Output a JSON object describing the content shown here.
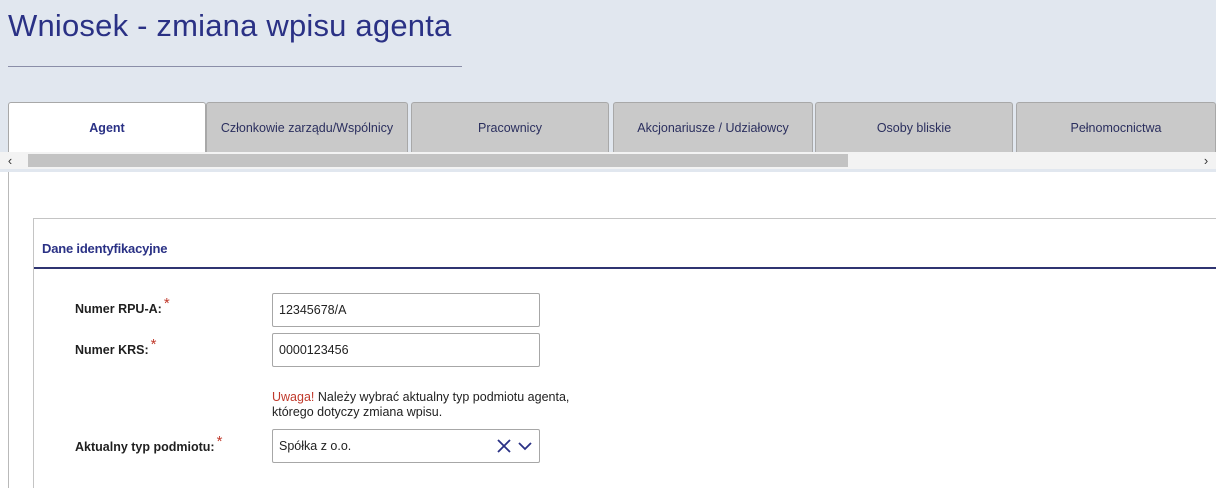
{
  "header": {
    "title": "Wniosek - zmiana wpisu agenta"
  },
  "tabs": [
    {
      "label": "Agent"
    },
    {
      "label": "Członkowie zarządu/Wspólnicy"
    },
    {
      "label": "Pracownicy"
    },
    {
      "label": "Akcjonariusze / Udziałowcy"
    },
    {
      "label": "Osoby bliskie"
    },
    {
      "label": "Pełnomocnictwa"
    }
  ],
  "active_tab": "Agent",
  "scroll": {
    "left_glyph": "‹",
    "right_glyph": "›"
  },
  "section": {
    "title": "Dane identyfikacyjne",
    "required_marker": "*",
    "fields": {
      "rpu": {
        "label": "Numer RPU-A:",
        "value": "12345678/A"
      },
      "krs": {
        "label": "Numer KRS:",
        "value": "0000123456"
      },
      "entity_type": {
        "label": "Aktualny typ podmiotu:",
        "value": "Spółka z o.o.",
        "warning_prefix": "Uwaga!",
        "warning_text": " Należy wybrać aktualny typ podmiotu agenta, którego dotyczy zmiana wpisu."
      }
    }
  },
  "colors": {
    "accent": "#2a3185",
    "required": "#c0392b",
    "header_bg": "#e1e7ef",
    "tab_inactive": "#c9c9c9"
  },
  "icons": {
    "clear": "close-icon",
    "expand": "chevron-down-icon"
  }
}
